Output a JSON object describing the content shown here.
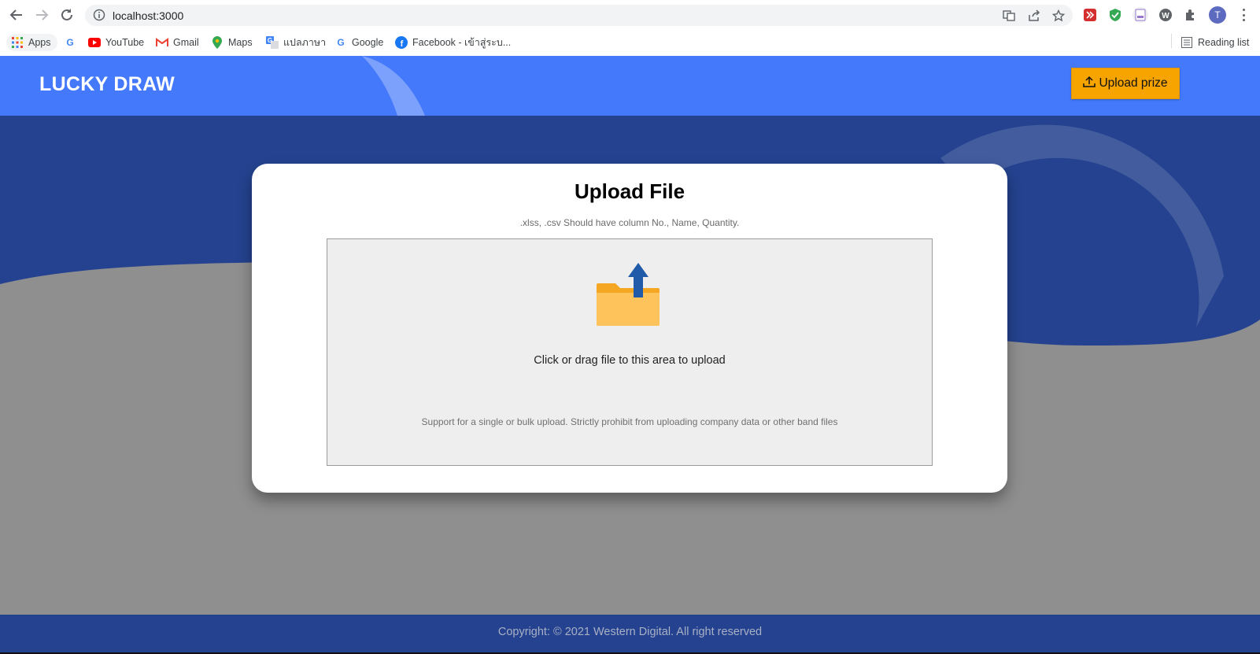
{
  "browser": {
    "url": "localhost:3000",
    "bookmarks": [
      {
        "label": "Apps",
        "icon": "apps-grid-icon"
      },
      {
        "label": "",
        "icon": "google-icon"
      },
      {
        "label": "YouTube",
        "icon": "youtube-icon"
      },
      {
        "label": "Gmail",
        "icon": "gmail-icon"
      },
      {
        "label": "Maps",
        "icon": "maps-pin-icon"
      },
      {
        "label": "แปลภาษา",
        "icon": "translate-icon"
      },
      {
        "label": "Google",
        "icon": "google-icon"
      },
      {
        "label": "Facebook - เข้าสู่ระบ...",
        "icon": "facebook-icon"
      }
    ],
    "reading_list": "Reading list",
    "avatar_initial": "T"
  },
  "header": {
    "brand": "LUCKY DRAW",
    "upload_button": "Upload prize"
  },
  "upload_card": {
    "title": "Upload File",
    "subtitle": ".xlss, .csv Should have column No., Name, Quantity.",
    "dropzone_text": "Click or drag file to this area to upload",
    "dropzone_hint": "Support for a single or bulk upload. Strictly prohibit from uploading company data or other band files"
  },
  "footer": {
    "copyright": "Copyright: © 2021 Western Digital. All right reserved"
  },
  "colors": {
    "header_blue": "#4479fb",
    "dark_blue": "#24428f",
    "upload_button": "#f7a400",
    "page_gray": "#8f8f8f"
  }
}
